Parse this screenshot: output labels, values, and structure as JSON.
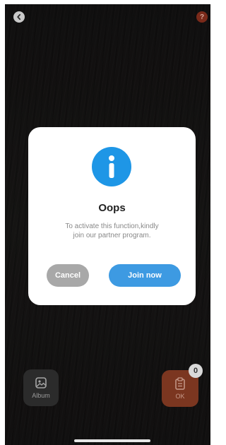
{
  "header": {
    "back_icon": "chevron-left-icon",
    "help_icon": "question-icon",
    "help_glyph": "?"
  },
  "dialog": {
    "icon": "info-icon",
    "title": "Oops",
    "message_line1": "To activate this function,kindly",
    "message_line2": "join our partner program.",
    "cancel_label": "Cancel",
    "join_label": "Join now"
  },
  "bottom_bar": {
    "album_label": "Album",
    "album_icon": "image-icon",
    "ok_label": "OK",
    "ok_icon": "clipboard-icon",
    "count": "0"
  },
  "colors": {
    "accent_blue": "#3d9ae2",
    "info_blue": "#1e96e6",
    "cancel_gray": "#a8a8a8",
    "ok_orange": "#7b3620",
    "help_red": "#7a2a1a"
  }
}
